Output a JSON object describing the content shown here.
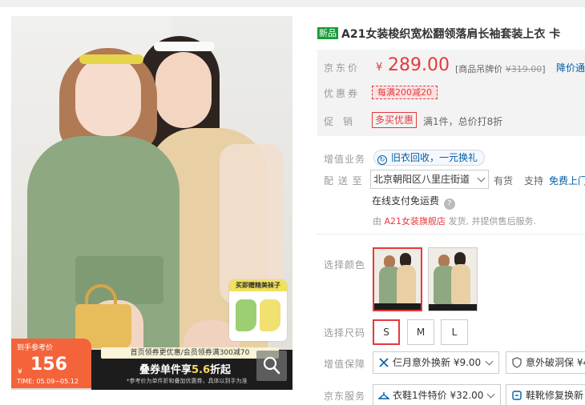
{
  "product": {
    "new_tag": "新品",
    "title": "A21女装梭织宽松翻领落肩长袖套装上衣 卡",
    "gift_label": "买即赠精美袜子"
  },
  "promo": {
    "badge_label": "到手参考价",
    "badge_currency": "¥",
    "badge_price": "156",
    "badge_time": "TIME: 05.09~05.12",
    "top_line": "首页领券更优惠/会员领券满300减70",
    "main_prefix": "叠券单件享",
    "main_highlight": "5.6",
    "main_suffix": "折起",
    "sub_line": "*参考价为单件折和叠加优惠券，具体以到手为准"
  },
  "pricing": {
    "price_label": "京东价",
    "currency": "¥",
    "price": "289.00",
    "list_price_label": "[商品吊牌价",
    "list_price": "¥319.00",
    "list_price_close": "]",
    "notify": "降价通知",
    "coupon_label": "优惠券",
    "coupon": "每满200减20",
    "promo_label": "促　销",
    "promo_tag": "多买优惠",
    "promo_desc": "满1件，总价打8折"
  },
  "service": {
    "extra_label": "增值业务",
    "recycle": "旧衣回收，一元换礼",
    "ship_label": "配 送 至",
    "address": "北京朝阳区八里庄街道",
    "stock": "有货",
    "support_label": "支持",
    "free_ship": "免费上门",
    "pay": "在线支付免运费",
    "seller_prefix": "由",
    "seller_shop": "A21女装旗舰店",
    "seller_suffix": "发货, 并提供售后服务."
  },
  "options": {
    "color_label": "选择颜色",
    "size_label": "选择尺码",
    "sizes": [
      "S",
      "M",
      "L"
    ],
    "selected_size": "S",
    "protect_label": "增值保障",
    "protect_1": "仨月意外换新 ¥9.00",
    "protect_2": "意外破洞保 ¥4",
    "jd_service_label": "京东服务",
    "jd_service_1": "衣鞋1件特价 ¥32.00",
    "jd_service_2": "鞋靴修复换新"
  },
  "colors": {
    "price_red": "#e4393c",
    "link_blue": "#005ea7",
    "new_green": "#1a9b3a"
  }
}
